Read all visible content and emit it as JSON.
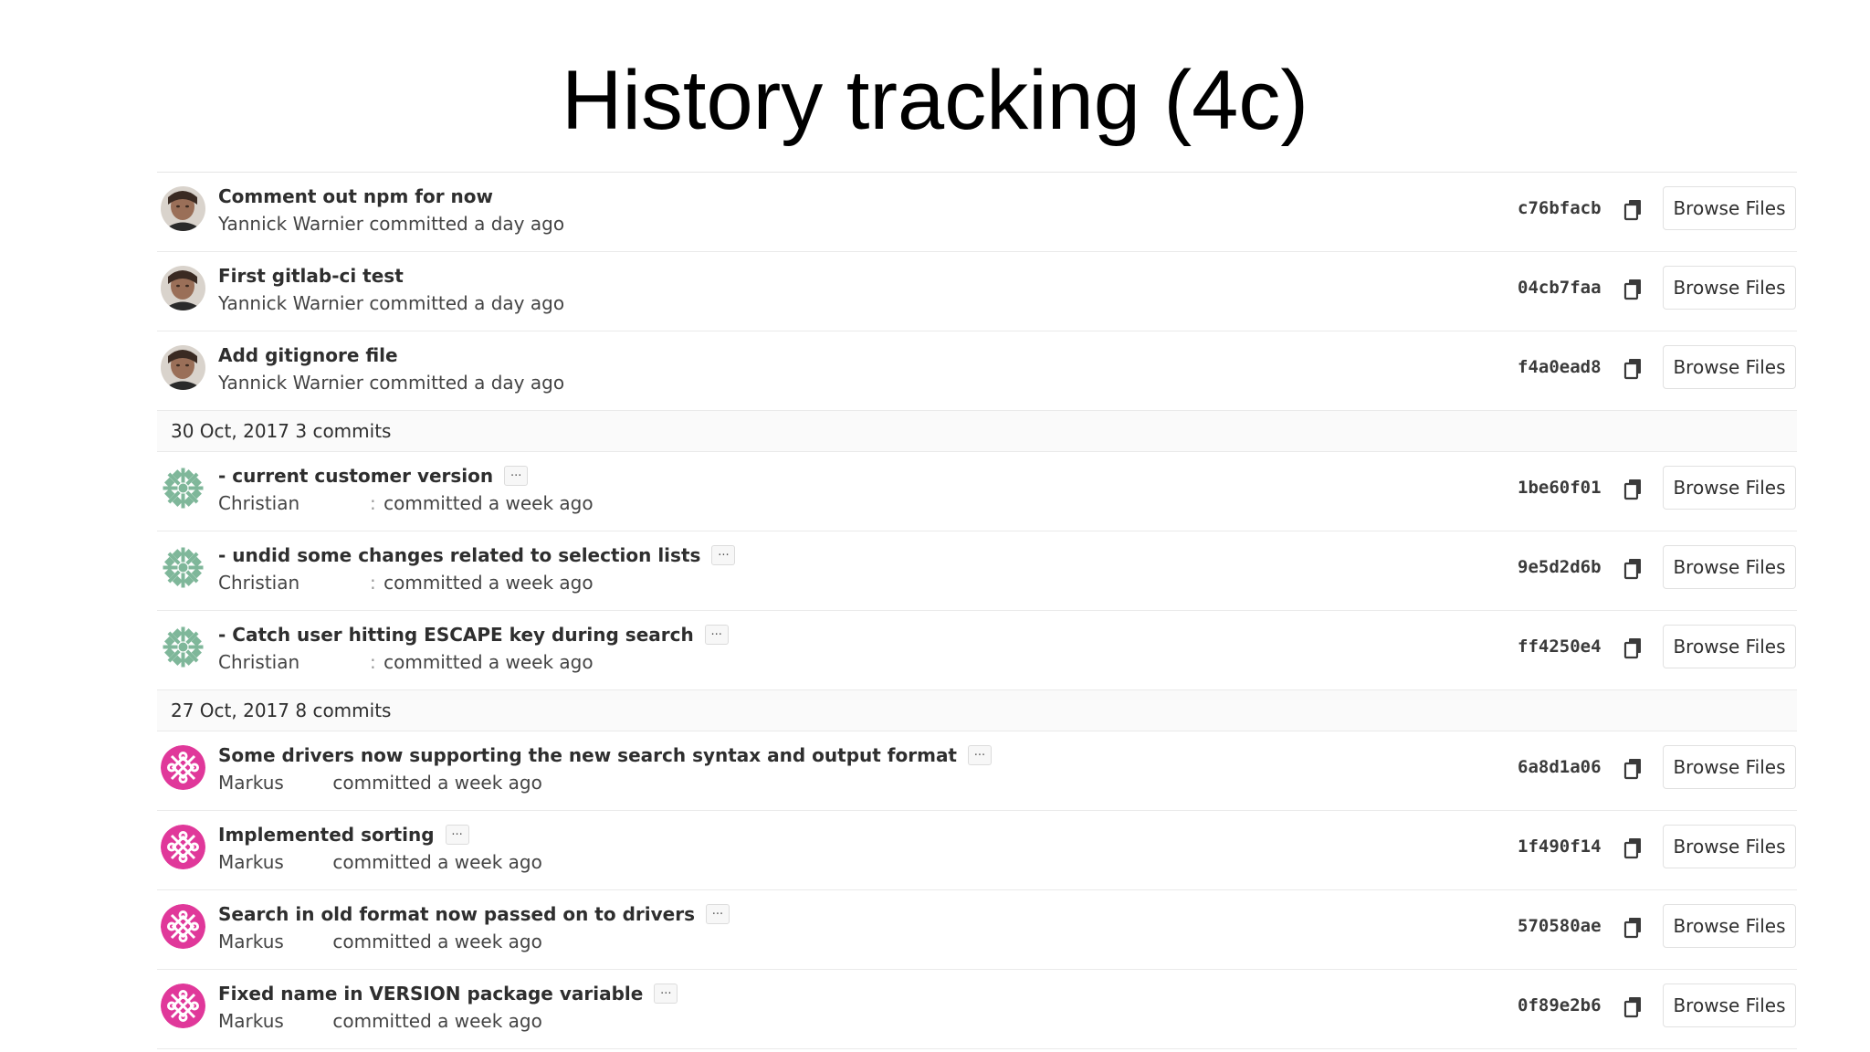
{
  "slide": {
    "title": "History tracking (4c)"
  },
  "labels": {
    "browse": "Browse Files",
    "ellipsis": "...",
    "committed": "committed"
  },
  "commits_top": [
    {
      "message": "Comment out npm for now",
      "author": "Yannick Warnier",
      "time": "a day ago",
      "sha": "c76bfacb",
      "avatar": "photo"
    },
    {
      "message": "First gitlab-ci test",
      "author": "Yannick Warnier",
      "time": "a day ago",
      "sha": "04cb7faa",
      "avatar": "photo"
    },
    {
      "message": "Add gitignore file",
      "author": "Yannick Warnier",
      "time": "a day ago",
      "sha": "f4a0ead8",
      "avatar": "photo"
    }
  ],
  "day_groups": [
    {
      "date": "30 Oct, 2017",
      "count": "3 commits",
      "commits": [
        {
          "message": "- current customer version",
          "author": "Christian",
          "time": "a week ago",
          "sha": "1be60f01",
          "avatar": "identicon-green"
        },
        {
          "message": "- undid some changes related to selection lists",
          "author": "Christian",
          "time": "a week ago",
          "sha": "9e5d2d6b",
          "avatar": "identicon-green"
        },
        {
          "message": "- Catch user hitting ESCAPE key during search",
          "author": "Christian",
          "time": "a week ago",
          "sha": "ff4250e4",
          "avatar": "identicon-green"
        }
      ]
    },
    {
      "date": "27 Oct, 2017",
      "count": "8 commits",
      "commits": [
        {
          "message": "Some drivers now supporting the new search syntax and output format",
          "author": "Markus",
          "time": "a week ago",
          "sha": "6a8d1a06",
          "avatar": "identicon-pink"
        },
        {
          "message": "Implemented sorting",
          "author": "Markus",
          "time": "a week ago",
          "sha": "1f490f14",
          "avatar": "identicon-pink"
        },
        {
          "message": "Search in old format now passed on to drivers",
          "author": "Markus",
          "time": "a week ago",
          "sha": "570580ae",
          "avatar": "identicon-pink"
        },
        {
          "message": "Fixed name in VERSION package variable",
          "author": "Markus",
          "time": "a week ago",
          "sha": "0f89e2b6",
          "avatar": "identicon-pink"
        }
      ]
    }
  ],
  "colors": {
    "identicon_green": "#7fb79a",
    "identicon_pink": "#e0389a"
  }
}
